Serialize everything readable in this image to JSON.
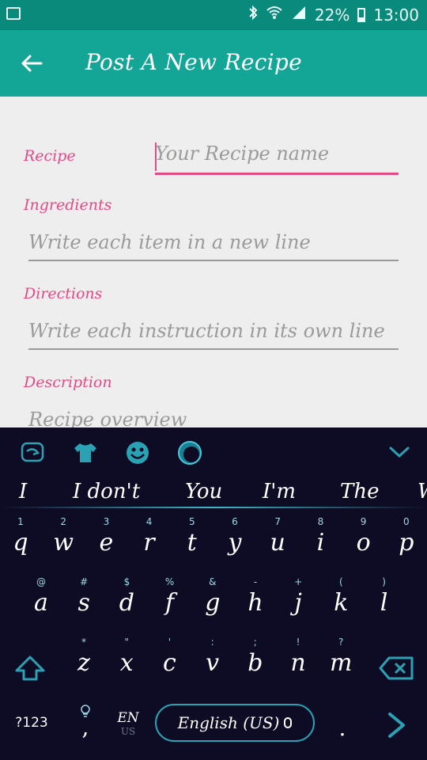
{
  "status_bar": {
    "battery_percent": "22%",
    "time": "13:00",
    "icons": [
      "bluetooth-icon",
      "wifi-icon",
      "signal-icon",
      "battery-icon",
      "screenshot-icon"
    ]
  },
  "toolbar": {
    "title": "Post A New Recipe",
    "back_icon": "arrow-left-icon"
  },
  "form": {
    "recipe": {
      "label": "Recipe",
      "placeholder": "Your Recipe name"
    },
    "ingredients": {
      "label": "Ingredients",
      "placeholder": "Write each item in a new line"
    },
    "directions": {
      "label": "Directions",
      "placeholder": "Write each instruction in its own line"
    },
    "description": {
      "label": "Description",
      "placeholder": "Recipe overview"
    }
  },
  "keyboard": {
    "toolbar_icons": [
      "swipe-icon",
      "theme-shirt-icon",
      "emoji-icon",
      "sphere-icon",
      "chevron-down-icon"
    ],
    "suggestions": [
      "I",
      "I don't",
      "You",
      "I'm",
      "The",
      "W"
    ],
    "row1": [
      {
        "h": "1",
        "k": "q"
      },
      {
        "h": "2",
        "k": "w"
      },
      {
        "h": "3",
        "k": "e"
      },
      {
        "h": "4",
        "k": "r"
      },
      {
        "h": "5",
        "k": "t"
      },
      {
        "h": "6",
        "k": "y"
      },
      {
        "h": "7",
        "k": "u"
      },
      {
        "h": "8",
        "k": "i"
      },
      {
        "h": "9",
        "k": "o"
      },
      {
        "h": "0",
        "k": "p"
      }
    ],
    "row2": [
      {
        "h": "@",
        "k": "a"
      },
      {
        "h": "#",
        "k": "s"
      },
      {
        "h": "$",
        "k": "d"
      },
      {
        "h": "%",
        "k": "f"
      },
      {
        "h": "&",
        "k": "g"
      },
      {
        "h": "-",
        "k": "h"
      },
      {
        "h": "+",
        "k": "j"
      },
      {
        "h": "(",
        "k": "k"
      },
      {
        "h": ")",
        "k": "l"
      }
    ],
    "row3": [
      {
        "h": "*",
        "k": "z"
      },
      {
        "h": "\"",
        "k": "x"
      },
      {
        "h": "'",
        "k": "c"
      },
      {
        "h": ":",
        "k": "v"
      },
      {
        "h": ";",
        "k": "b"
      },
      {
        "h": "!",
        "k": "n"
      },
      {
        "h": "?",
        "k": "m"
      }
    ],
    "symbols_label": "?123",
    "comma_label": ",",
    "language_code": "EN",
    "language_sub": "US",
    "space_label": "English (US)",
    "period_label": ".",
    "accent": "#2aa2b4"
  }
}
